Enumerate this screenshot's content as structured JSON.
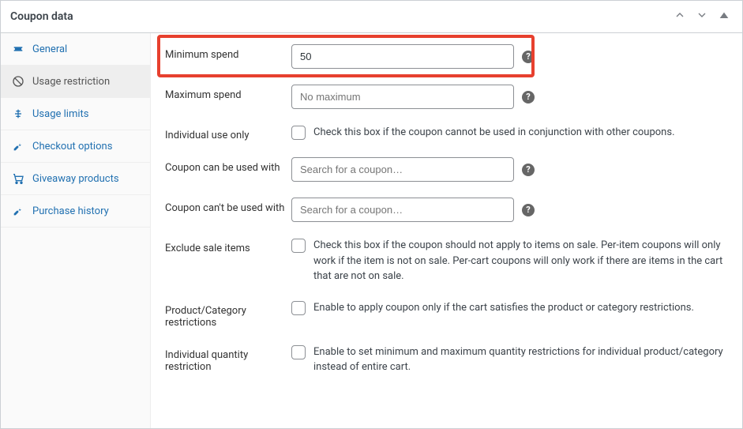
{
  "header": {
    "title": "Coupon data"
  },
  "sidebar": {
    "items": [
      {
        "label": "General"
      },
      {
        "label": "Usage restriction"
      },
      {
        "label": "Usage limits"
      },
      {
        "label": "Checkout options"
      },
      {
        "label": "Giveaway products"
      },
      {
        "label": "Purchase history"
      }
    ]
  },
  "form": {
    "minSpend": {
      "label": "Minimum spend",
      "value": "50"
    },
    "maxSpend": {
      "label": "Maximum spend",
      "placeholder": "No maximum"
    },
    "individualUse": {
      "label": "Individual use only",
      "desc": "Check this box if the coupon cannot be used in conjunction with other coupons."
    },
    "usedWith": {
      "label": "Coupon can be used with",
      "placeholder": "Search for a coupon…"
    },
    "notUsedWith": {
      "label": "Coupon can't be used with",
      "placeholder": "Search for a coupon…"
    },
    "excludeSale": {
      "label": "Exclude sale items",
      "desc": "Check this box if the coupon should not apply to items on sale. Per-item coupons will only work if the item is not on sale. Per-cart coupons will only work if there are items in the cart that are not on sale."
    },
    "prodCatRestrict": {
      "label": "Product/Category restrictions",
      "desc": "Enable to apply coupon only if the cart satisfies the product or category restrictions."
    },
    "indivQtyRestrict": {
      "label": "Individual quantity restriction",
      "desc": "Enable to set minimum and maximum quantity restrictions for individual product/category instead of entire cart."
    }
  }
}
